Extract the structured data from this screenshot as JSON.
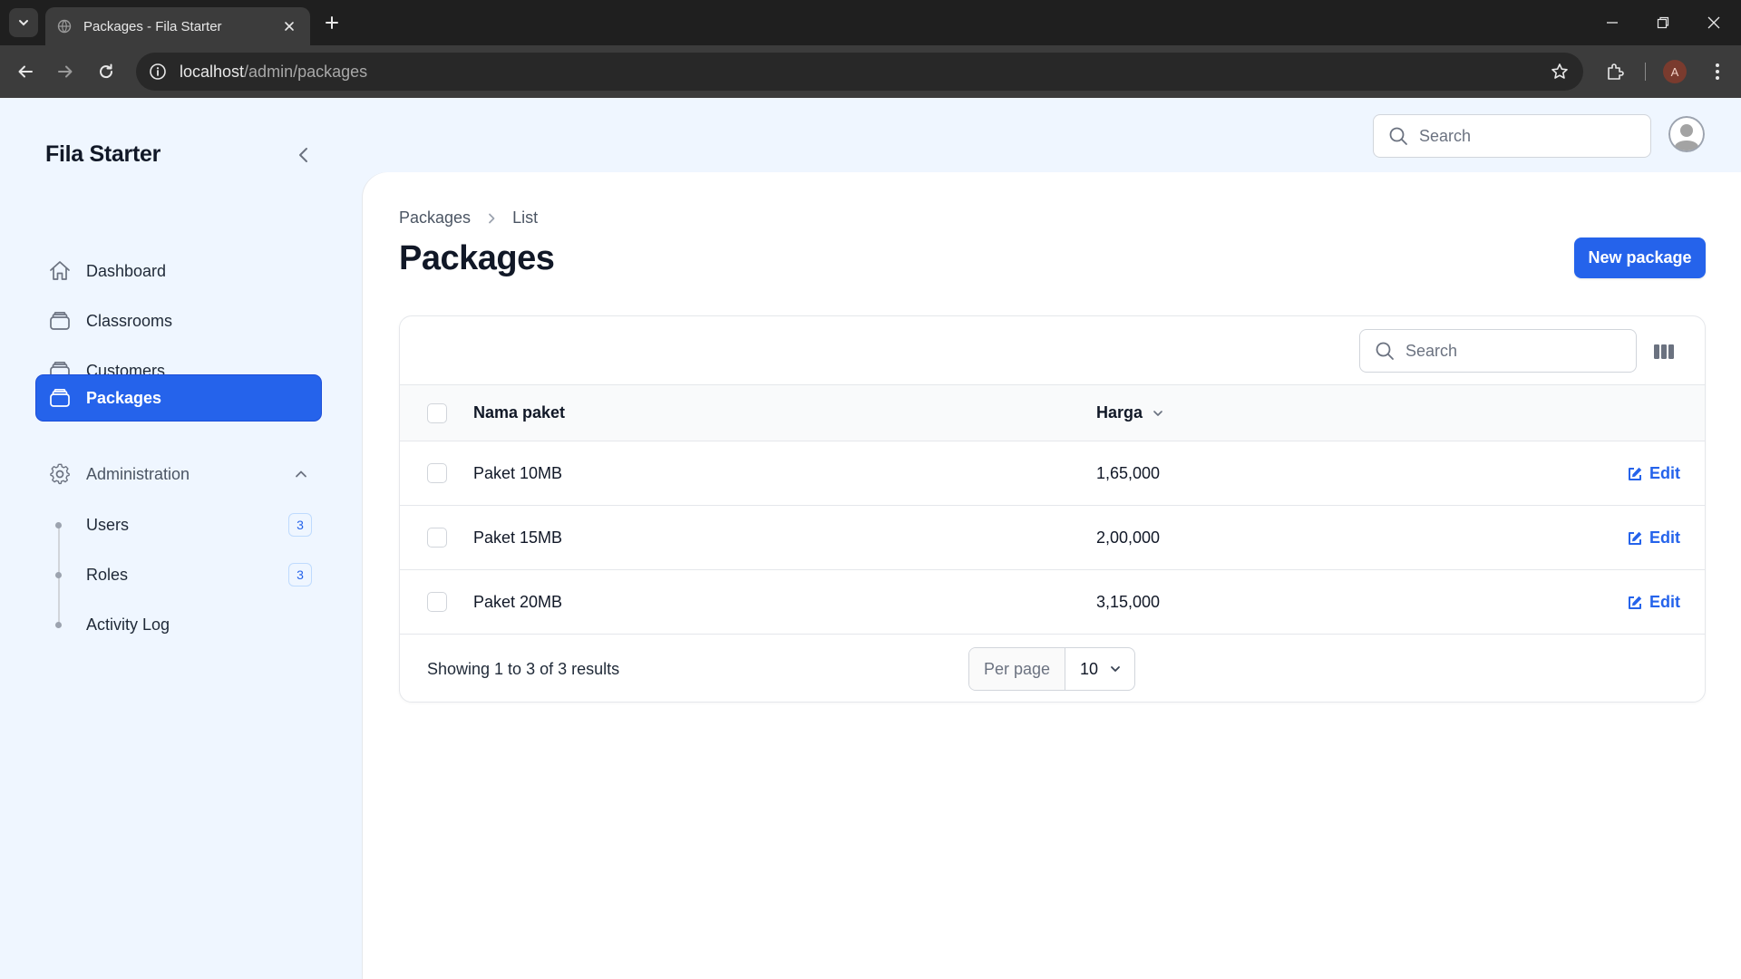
{
  "browser": {
    "tab_title": "Packages - Fila Starter",
    "url_host": "localhost",
    "url_path": "/admin/packages",
    "profile_initial": "A"
  },
  "sidebar": {
    "brand": "Fila Starter",
    "items": [
      {
        "label": "Dashboard",
        "icon": "home-icon",
        "active": false
      },
      {
        "label": "Classrooms",
        "icon": "stack-icon",
        "active": false
      },
      {
        "label": "Customers",
        "icon": "stack-icon",
        "active": false
      },
      {
        "label": "Packages",
        "icon": "stack-icon",
        "active": true
      }
    ],
    "group": {
      "label": "Administration",
      "icon": "gear-icon",
      "items": [
        {
          "label": "Users",
          "badge": "3"
        },
        {
          "label": "Roles",
          "badge": "3"
        },
        {
          "label": "Activity Log"
        }
      ]
    }
  },
  "topbar": {
    "search_placeholder": "Search"
  },
  "page": {
    "breadcrumb": [
      "Packages",
      "List"
    ],
    "title": "Packages",
    "new_button": "New package"
  },
  "table": {
    "search_placeholder": "Search",
    "columns": [
      "Nama paket",
      "Harga"
    ],
    "rows": [
      {
        "name": "Paket 10MB",
        "price": "1,65,000",
        "action": "Edit"
      },
      {
        "name": "Paket 15MB",
        "price": "2,00,000",
        "action": "Edit"
      },
      {
        "name": "Paket 20MB",
        "price": "3,15,000",
        "action": "Edit"
      }
    ],
    "showing": "Showing 1 to 3 of 3 results",
    "per_page_label": "Per page",
    "per_page_value": "10"
  },
  "colors": {
    "accent": "#2563eb",
    "sidebar_bg": "#eff6ff"
  }
}
